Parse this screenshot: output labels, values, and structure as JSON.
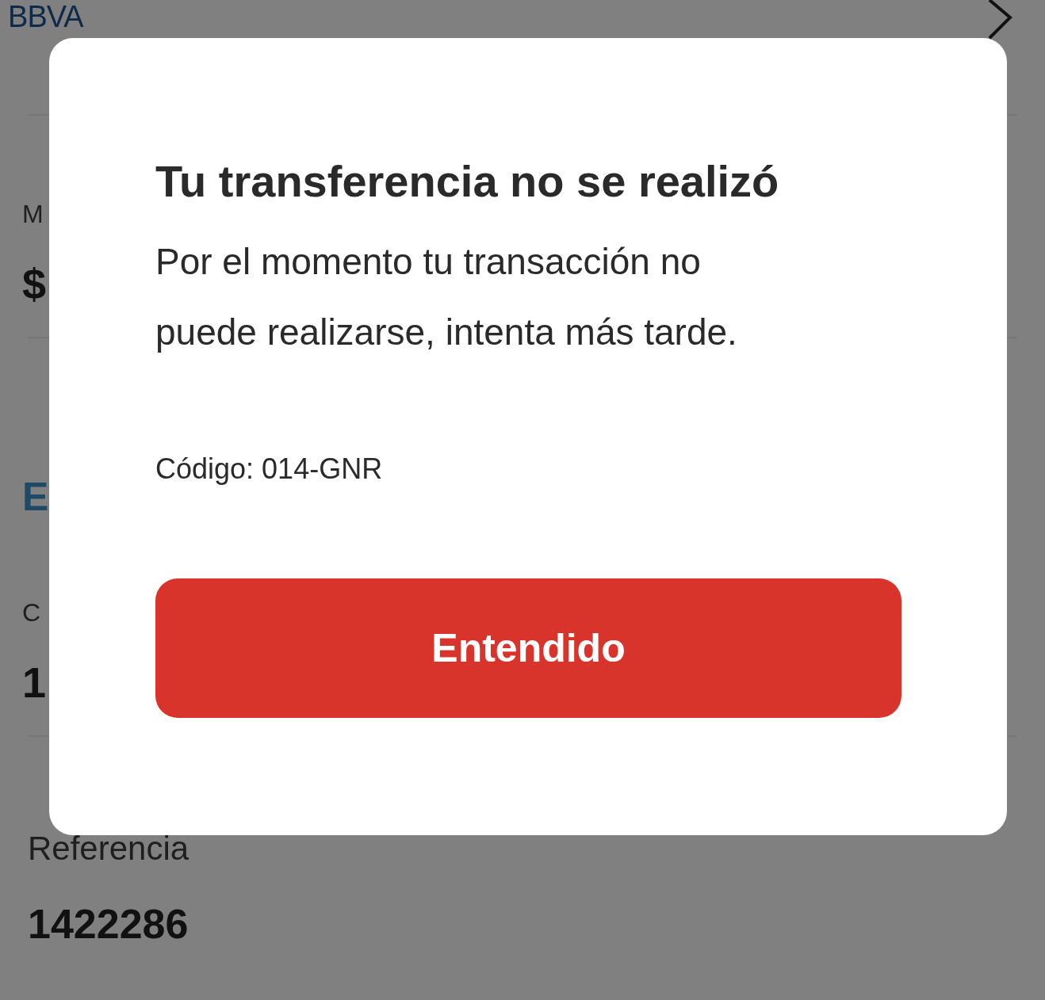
{
  "background": {
    "logo": "BBVA",
    "partial_texts": [
      {
        "kind": "label",
        "text": "M"
      },
      {
        "kind": "amount",
        "text": "$"
      },
      {
        "kind": "heading",
        "text": "E"
      },
      {
        "kind": "label",
        "text": "C"
      },
      {
        "kind": "amount",
        "text": "1"
      }
    ],
    "reference": {
      "label": "Referencia",
      "value": "1422286"
    }
  },
  "dialog": {
    "title": "Tu transferencia no se realizó",
    "message": "Por el momento tu transacción no puede realizarse, intenta más tarde.",
    "code": "Código: 014-GNR",
    "button": "Entendido"
  }
}
